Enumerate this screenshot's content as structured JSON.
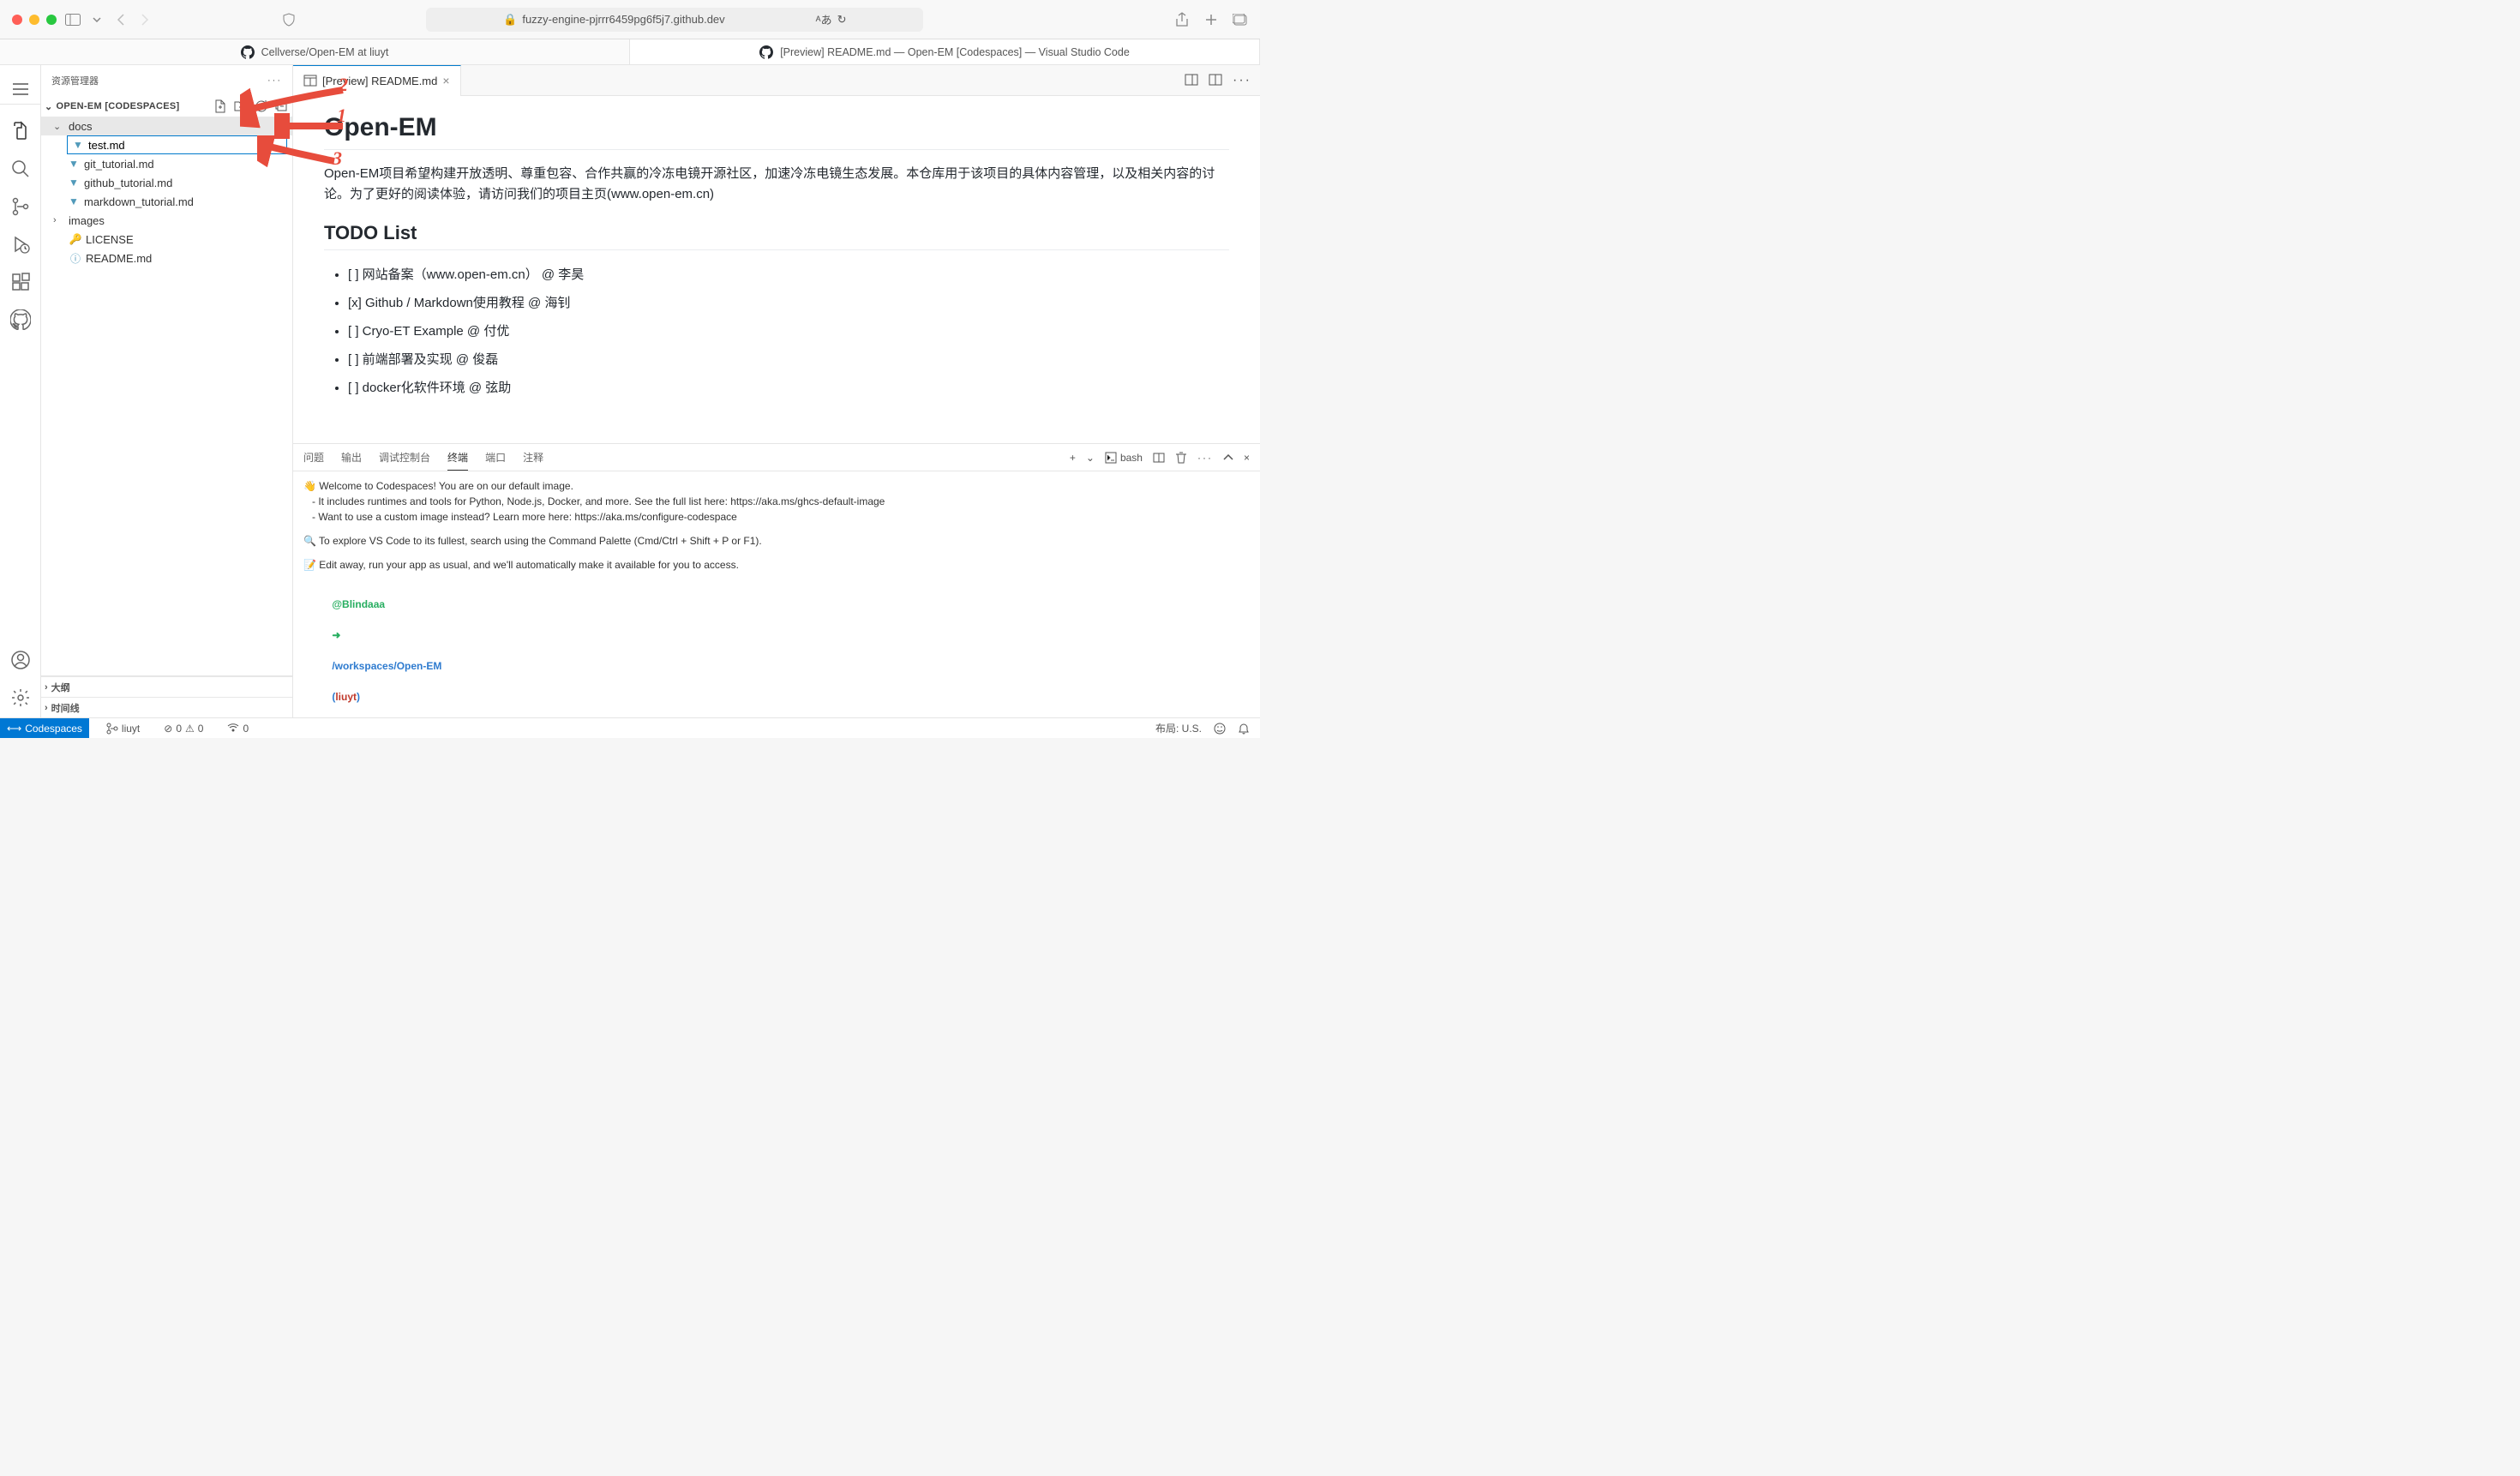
{
  "browser": {
    "url": "fuzzy-engine-pjrrr6459pg6f5j7.github.dev",
    "tabs": [
      "Cellverse/Open-EM at liuyt",
      "[Preview] README.md — Open-EM [Codespaces] — Visual Studio Code"
    ]
  },
  "sidebar": {
    "title": "资源管理器",
    "section_title": "OPEN-EM [CODESPACES]",
    "tree": {
      "docs": "docs",
      "new_file_value": "test.md",
      "files": [
        "git_tutorial.md",
        "github_tutorial.md",
        "markdown_tutorial.md"
      ],
      "images": "images",
      "license": "LICENSE",
      "readme": "README.md"
    },
    "outline": "大纲",
    "timeline": "时间线"
  },
  "editor": {
    "tab_label": "[Preview] README.md",
    "preview": {
      "h1": "Open-EM",
      "intro": "Open-EM项目希望构建开放透明、尊重包容、合作共赢的冷冻电镜开源社区，加速冷冻电镜生态发展。本仓库用于该项目的具体内容管理，以及相关内容的讨论。为了更好的阅读体验，请访问我们的项目主页(www.open-em.cn)",
      "h2": "TODO List",
      "todos": [
        "[ ] 网站备案（www.open-em.cn） @ 李昊",
        "[x] Github / Markdown使用教程 @ 海钊",
        "[ ] Cryo-ET Example @ 付优",
        "[ ] 前端部署及实现 @ 俊磊",
        "[ ] docker化软件环境 @ 弦助"
      ]
    }
  },
  "terminal": {
    "tabs": [
      "问题",
      "输出",
      "调试控制台",
      "终端",
      "端口",
      "注释"
    ],
    "shell_label": "bash",
    "lines": {
      "l1": "👋 Welcome to Codespaces! You are on our default image.",
      "l2": "   - It includes runtimes and tools for Python, Node.js, Docker, and more. See the full list here: https://aka.ms/ghcs-default-image",
      "l3": "   - Want to use a custom image instead? Learn more here: https://aka.ms/configure-codespace",
      "l4": "🔍 To explore VS Code to its fullest, search using the Command Palette (Cmd/Ctrl + Shift + P or F1).",
      "l5": "📝 Edit away, run your app as usual, and we'll automatically make it available for you to access.",
      "prompt_user": "@Blindaaa",
      "prompt_arrow": "➜",
      "prompt_path": "/workspaces/Open-EM",
      "prompt_branch": "liuyt",
      "prompt_sym": "$"
    }
  },
  "status_bar": {
    "codespaces": "Codespaces",
    "branch": "liuyt",
    "errors": "0",
    "warnings": "0",
    "ports": "0",
    "layout_label": "布局: U.S."
  },
  "annotations": {
    "a1": "1",
    "a2": "2",
    "a3": "3"
  }
}
